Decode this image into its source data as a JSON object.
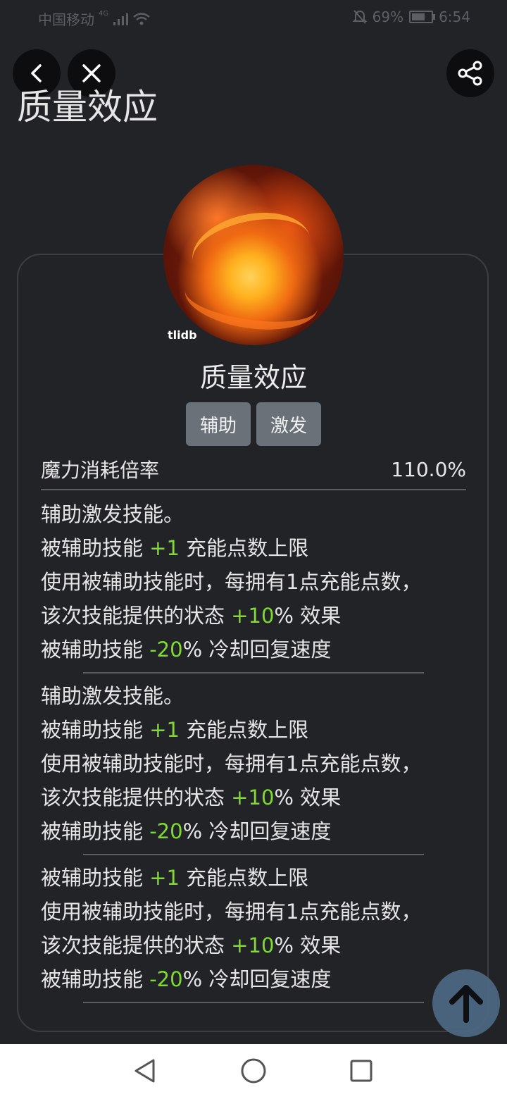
{
  "status_bar": {
    "carrier": "中国移动",
    "network": "4G",
    "battery": "69%",
    "battery_level": 0.69,
    "time": "6:54"
  },
  "page": {
    "title": "质量效应"
  },
  "icons": {
    "back": "back-chevron-icon",
    "close": "close-icon",
    "share": "share-icon",
    "scroll_top": "arrow-up-icon"
  },
  "skill": {
    "watermark": "tlidb",
    "name": "质量效应",
    "tags": [
      "辅助",
      "激发"
    ],
    "stat": {
      "label": "魔力消耗倍率",
      "value": "110.0%"
    },
    "sections": [
      {
        "lines": [
          {
            "pre": "辅助激发技能。",
            "hl": "",
            "post": ""
          },
          {
            "pre": "被辅助技能 ",
            "hl": "+1",
            "post": " 充能点数上限"
          },
          {
            "pre": "使用被辅助技能时，每拥有1点充能点数，",
            "hl": "",
            "post": ""
          },
          {
            "pre": "该次技能提供的状态 ",
            "hl": "+10",
            "post": "% 效果"
          },
          {
            "pre": "被辅助技能 ",
            "hl": "-20",
            "post": "% 冷却回复速度"
          }
        ]
      },
      {
        "lines": [
          {
            "pre": "辅助激发技能。",
            "hl": "",
            "post": ""
          },
          {
            "pre": "被辅助技能 ",
            "hl": "+1",
            "post": " 充能点数上限"
          },
          {
            "pre": "使用被辅助技能时，每拥有1点充能点数，",
            "hl": "",
            "post": ""
          },
          {
            "pre": "该次技能提供的状态 ",
            "hl": "+10",
            "post": "% 效果"
          },
          {
            "pre": "被辅助技能 ",
            "hl": "-20",
            "post": "% 冷却回复速度"
          }
        ]
      },
      {
        "lines": [
          {
            "pre": "被辅助技能 ",
            "hl": "+1",
            "post": " 充能点数上限"
          },
          {
            "pre": "使用被辅助技能时，每拥有1点充能点数，",
            "hl": "",
            "post": ""
          },
          {
            "pre": "该次技能提供的状态 ",
            "hl": "+10",
            "post": "% 效果"
          },
          {
            "pre": "被辅助技能 ",
            "hl": "-20",
            "post": "% 冷却回复速度"
          }
        ]
      }
    ]
  },
  "colors": {
    "background": "#212327",
    "highlight": "#7ddc2e",
    "tag_bg": "#6b7178",
    "scroll_top_bg": "#4d6a85"
  },
  "nav_bar": {
    "buttons": [
      "back-triangle-icon",
      "home-circle-icon",
      "recents-square-icon"
    ]
  }
}
